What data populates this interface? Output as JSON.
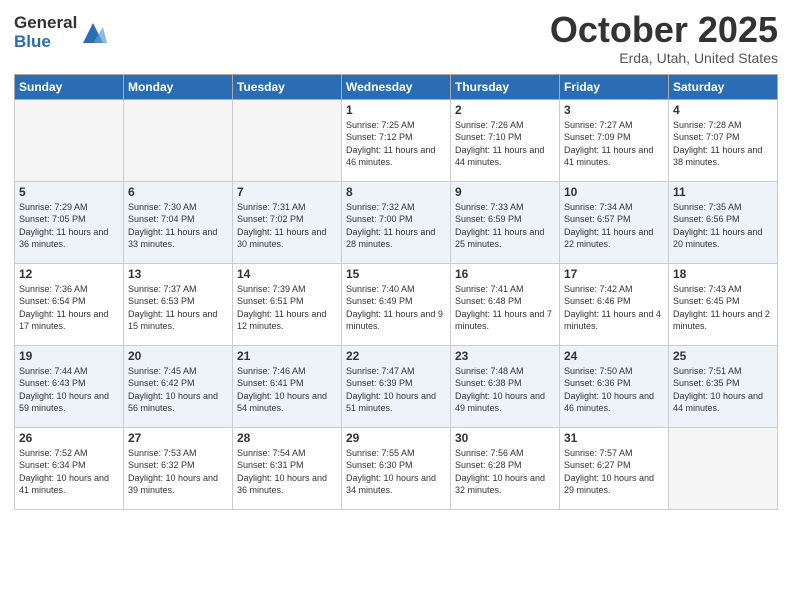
{
  "header": {
    "logo_general": "General",
    "logo_blue": "Blue",
    "month_title": "October 2025",
    "subtitle": "Erda, Utah, United States"
  },
  "days_of_week": [
    "Sunday",
    "Monday",
    "Tuesday",
    "Wednesday",
    "Thursday",
    "Friday",
    "Saturday"
  ],
  "weeks": [
    [
      {
        "day": "",
        "sunrise": "",
        "sunset": "",
        "daylight": "",
        "empty": true
      },
      {
        "day": "",
        "sunrise": "",
        "sunset": "",
        "daylight": "",
        "empty": true
      },
      {
        "day": "",
        "sunrise": "",
        "sunset": "",
        "daylight": "",
        "empty": true
      },
      {
        "day": "1",
        "sunrise": "Sunrise: 7:25 AM",
        "sunset": "Sunset: 7:12 PM",
        "daylight": "Daylight: 11 hours and 46 minutes.",
        "empty": false
      },
      {
        "day": "2",
        "sunrise": "Sunrise: 7:26 AM",
        "sunset": "Sunset: 7:10 PM",
        "daylight": "Daylight: 11 hours and 44 minutes.",
        "empty": false
      },
      {
        "day": "3",
        "sunrise": "Sunrise: 7:27 AM",
        "sunset": "Sunset: 7:09 PM",
        "daylight": "Daylight: 11 hours and 41 minutes.",
        "empty": false
      },
      {
        "day": "4",
        "sunrise": "Sunrise: 7:28 AM",
        "sunset": "Sunset: 7:07 PM",
        "daylight": "Daylight: 11 hours and 38 minutes.",
        "empty": false
      }
    ],
    [
      {
        "day": "5",
        "sunrise": "Sunrise: 7:29 AM",
        "sunset": "Sunset: 7:05 PM",
        "daylight": "Daylight: 11 hours and 36 minutes.",
        "empty": false
      },
      {
        "day": "6",
        "sunrise": "Sunrise: 7:30 AM",
        "sunset": "Sunset: 7:04 PM",
        "daylight": "Daylight: 11 hours and 33 minutes.",
        "empty": false
      },
      {
        "day": "7",
        "sunrise": "Sunrise: 7:31 AM",
        "sunset": "Sunset: 7:02 PM",
        "daylight": "Daylight: 11 hours and 30 minutes.",
        "empty": false
      },
      {
        "day": "8",
        "sunrise": "Sunrise: 7:32 AM",
        "sunset": "Sunset: 7:00 PM",
        "daylight": "Daylight: 11 hours and 28 minutes.",
        "empty": false
      },
      {
        "day": "9",
        "sunrise": "Sunrise: 7:33 AM",
        "sunset": "Sunset: 6:59 PM",
        "daylight": "Daylight: 11 hours and 25 minutes.",
        "empty": false
      },
      {
        "day": "10",
        "sunrise": "Sunrise: 7:34 AM",
        "sunset": "Sunset: 6:57 PM",
        "daylight": "Daylight: 11 hours and 22 minutes.",
        "empty": false
      },
      {
        "day": "11",
        "sunrise": "Sunrise: 7:35 AM",
        "sunset": "Sunset: 6:56 PM",
        "daylight": "Daylight: 11 hours and 20 minutes.",
        "empty": false
      }
    ],
    [
      {
        "day": "12",
        "sunrise": "Sunrise: 7:36 AM",
        "sunset": "Sunset: 6:54 PM",
        "daylight": "Daylight: 11 hours and 17 minutes.",
        "empty": false
      },
      {
        "day": "13",
        "sunrise": "Sunrise: 7:37 AM",
        "sunset": "Sunset: 6:53 PM",
        "daylight": "Daylight: 11 hours and 15 minutes.",
        "empty": false
      },
      {
        "day": "14",
        "sunrise": "Sunrise: 7:39 AM",
        "sunset": "Sunset: 6:51 PM",
        "daylight": "Daylight: 11 hours and 12 minutes.",
        "empty": false
      },
      {
        "day": "15",
        "sunrise": "Sunrise: 7:40 AM",
        "sunset": "Sunset: 6:49 PM",
        "daylight": "Daylight: 11 hours and 9 minutes.",
        "empty": false
      },
      {
        "day": "16",
        "sunrise": "Sunrise: 7:41 AM",
        "sunset": "Sunset: 6:48 PM",
        "daylight": "Daylight: 11 hours and 7 minutes.",
        "empty": false
      },
      {
        "day": "17",
        "sunrise": "Sunrise: 7:42 AM",
        "sunset": "Sunset: 6:46 PM",
        "daylight": "Daylight: 11 hours and 4 minutes.",
        "empty": false
      },
      {
        "day": "18",
        "sunrise": "Sunrise: 7:43 AM",
        "sunset": "Sunset: 6:45 PM",
        "daylight": "Daylight: 11 hours and 2 minutes.",
        "empty": false
      }
    ],
    [
      {
        "day": "19",
        "sunrise": "Sunrise: 7:44 AM",
        "sunset": "Sunset: 6:43 PM",
        "daylight": "Daylight: 10 hours and 59 minutes.",
        "empty": false
      },
      {
        "day": "20",
        "sunrise": "Sunrise: 7:45 AM",
        "sunset": "Sunset: 6:42 PM",
        "daylight": "Daylight: 10 hours and 56 minutes.",
        "empty": false
      },
      {
        "day": "21",
        "sunrise": "Sunrise: 7:46 AM",
        "sunset": "Sunset: 6:41 PM",
        "daylight": "Daylight: 10 hours and 54 minutes.",
        "empty": false
      },
      {
        "day": "22",
        "sunrise": "Sunrise: 7:47 AM",
        "sunset": "Sunset: 6:39 PM",
        "daylight": "Daylight: 10 hours and 51 minutes.",
        "empty": false
      },
      {
        "day": "23",
        "sunrise": "Sunrise: 7:48 AM",
        "sunset": "Sunset: 6:38 PM",
        "daylight": "Daylight: 10 hours and 49 minutes.",
        "empty": false
      },
      {
        "day": "24",
        "sunrise": "Sunrise: 7:50 AM",
        "sunset": "Sunset: 6:36 PM",
        "daylight": "Daylight: 10 hours and 46 minutes.",
        "empty": false
      },
      {
        "day": "25",
        "sunrise": "Sunrise: 7:51 AM",
        "sunset": "Sunset: 6:35 PM",
        "daylight": "Daylight: 10 hours and 44 minutes.",
        "empty": false
      }
    ],
    [
      {
        "day": "26",
        "sunrise": "Sunrise: 7:52 AM",
        "sunset": "Sunset: 6:34 PM",
        "daylight": "Daylight: 10 hours and 41 minutes.",
        "empty": false
      },
      {
        "day": "27",
        "sunrise": "Sunrise: 7:53 AM",
        "sunset": "Sunset: 6:32 PM",
        "daylight": "Daylight: 10 hours and 39 minutes.",
        "empty": false
      },
      {
        "day": "28",
        "sunrise": "Sunrise: 7:54 AM",
        "sunset": "Sunset: 6:31 PM",
        "daylight": "Daylight: 10 hours and 36 minutes.",
        "empty": false
      },
      {
        "day": "29",
        "sunrise": "Sunrise: 7:55 AM",
        "sunset": "Sunset: 6:30 PM",
        "daylight": "Daylight: 10 hours and 34 minutes.",
        "empty": false
      },
      {
        "day": "30",
        "sunrise": "Sunrise: 7:56 AM",
        "sunset": "Sunset: 6:28 PM",
        "daylight": "Daylight: 10 hours and 32 minutes.",
        "empty": false
      },
      {
        "day": "31",
        "sunrise": "Sunrise: 7:57 AM",
        "sunset": "Sunset: 6:27 PM",
        "daylight": "Daylight: 10 hours and 29 minutes.",
        "empty": false
      },
      {
        "day": "",
        "sunrise": "",
        "sunset": "",
        "daylight": "",
        "empty": true
      }
    ]
  ]
}
